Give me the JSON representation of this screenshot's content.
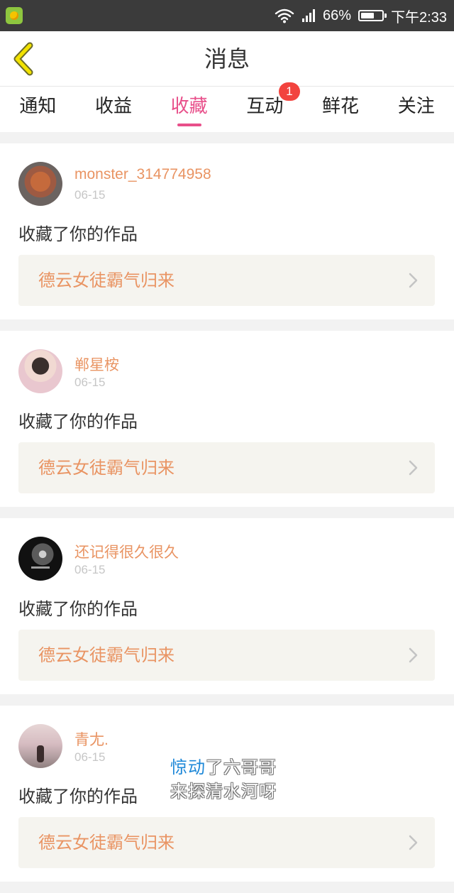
{
  "status_bar": {
    "battery": "66%",
    "battery_level": 0.66,
    "time": "下午2:33"
  },
  "header": {
    "title": "消息"
  },
  "tabs": [
    {
      "label": "通知"
    },
    {
      "label": "收益"
    },
    {
      "label": "收藏",
      "active": true
    },
    {
      "label": "互动",
      "badge": "1"
    },
    {
      "label": "鲜花"
    },
    {
      "label": "关注"
    }
  ],
  "feed": [
    {
      "username": "monster_314774958",
      "date": "06-15",
      "action": "收藏了你的作品",
      "work_title": "德云女徒霸气归来"
    },
    {
      "username": "郸星桉",
      "date": "06-15",
      "action": "收藏了你的作品",
      "work_title": "德云女徒霸气归来"
    },
    {
      "username": "还记得很久很久",
      "date": "06-15",
      "action": "收藏了你的作品",
      "work_title": "德云女徒霸气归来"
    },
    {
      "username": "青尢.",
      "date": "06-15",
      "action": "收藏了你的作品",
      "work_title": "德云女徒霸气归来"
    }
  ],
  "caption": {
    "line1_highlight": "惊动",
    "line1_rest": "了六哥哥",
    "line2": "来探清水河呀"
  },
  "colors": {
    "accent": "#e84f8a",
    "username": "#e99463",
    "badge": "#f2433e",
    "status_bar": "#3b3b3b"
  },
  "icons": [
    "app-icon",
    "wifi-icon",
    "signal-icon",
    "battery-icon",
    "back-arrow-icon",
    "chevron-right-icon"
  ]
}
